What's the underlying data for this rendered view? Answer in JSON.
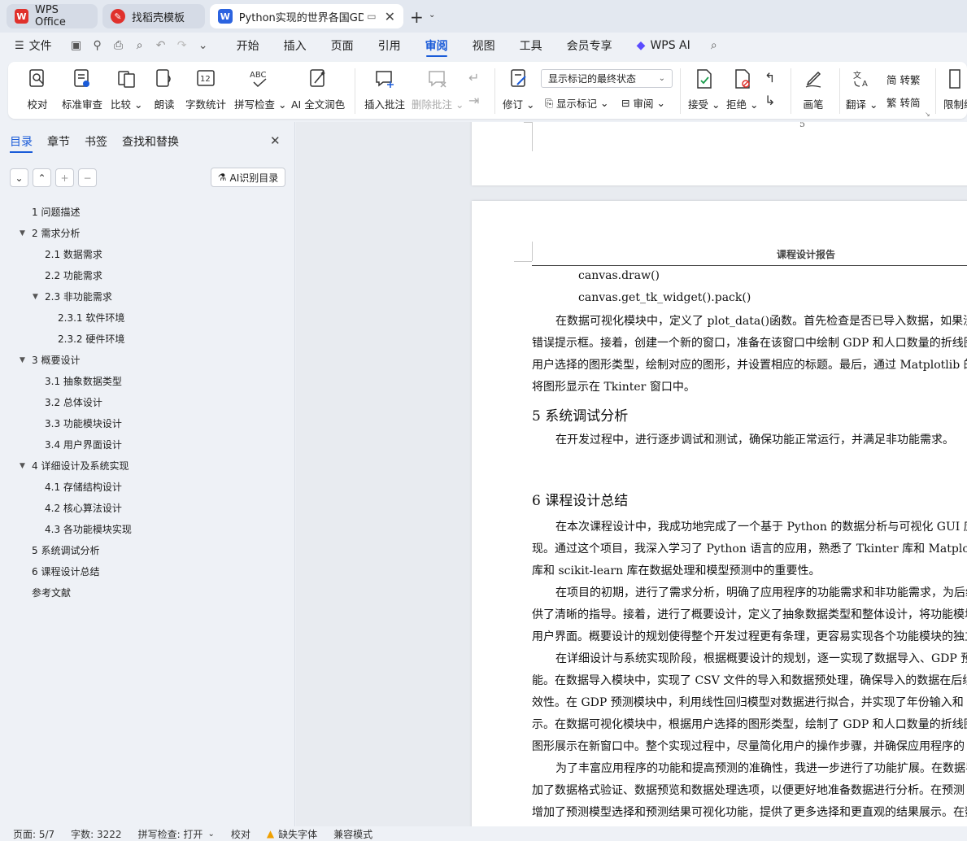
{
  "tabs": [
    {
      "label": "WPS Office",
      "icon": "wps-logo"
    },
    {
      "label": "找稻壳模板",
      "icon": "docer-logo"
    },
    {
      "label": "Python实现的世界各国GDP和",
      "icon": "writer-logo"
    }
  ],
  "menu": {
    "file": "文件",
    "items": [
      "开始",
      "插入",
      "页面",
      "引用",
      "审阅",
      "视图",
      "工具",
      "会员专享"
    ],
    "active": "审阅",
    "wps_ai": "WPS AI"
  },
  "ribbon": {
    "proofread": "校对",
    "std_review": "标准审查",
    "compare": "比较",
    "read_aloud": "朗读",
    "word_count": "字数统计",
    "spell_check": "拼写检查",
    "ai_polish": "AI 全文润色",
    "insert_comment": "插入批注",
    "delete_comment": "删除批注",
    "revise": "修订",
    "markup_select": "显示标记的最终状态",
    "show_markup": "显示标记",
    "review": "审阅",
    "accept": "接受",
    "reject": "拒绝",
    "pen": "画笔",
    "translate": "翻译",
    "to_traditional": "转繁",
    "to_simplified": "转简",
    "restrict": "限制编"
  },
  "panel": {
    "tabs": [
      "目录",
      "章节",
      "书签",
      "查找和替换"
    ],
    "ai_toc": "AI识别目录",
    "toc": [
      {
        "label": "1  问题描述",
        "level": 1,
        "arrow": false
      },
      {
        "label": "2  需求分析",
        "level": 1,
        "arrow": true
      },
      {
        "label": "2.1  数据需求",
        "level": 2,
        "arrow": false
      },
      {
        "label": "2.2  功能需求",
        "level": 2,
        "arrow": false
      },
      {
        "label": "2.3  非功能需求",
        "level": 2,
        "arrow": true
      },
      {
        "label": "2.3.1 软件环境",
        "level": 3,
        "arrow": false
      },
      {
        "label": "2.3.2 硬件环境",
        "level": 3,
        "arrow": false
      },
      {
        "label": "3  概要设计",
        "level": 1,
        "arrow": true
      },
      {
        "label": "3.1 抽象数据类型",
        "level": 2,
        "arrow": false
      },
      {
        "label": "3.2  总体设计",
        "level": 2,
        "arrow": false
      },
      {
        "label": "3.3  功能模块设计",
        "level": 2,
        "arrow": false
      },
      {
        "label": "3.4  用户界面设计",
        "level": 2,
        "arrow": false
      },
      {
        "label": "4  详细设计及系统实现",
        "level": 1,
        "arrow": true
      },
      {
        "label": "4.1  存储结构设计",
        "level": 2,
        "arrow": false
      },
      {
        "label": "4.2  核心算法设计",
        "level": 2,
        "arrow": false
      },
      {
        "label": "4.3  各功能模块实现",
        "level": 2,
        "arrow": false
      },
      {
        "label": "5  系统调试分析",
        "level": 1,
        "arrow": false
      },
      {
        "label": "6  课程设计总结",
        "level": 1,
        "arrow": false
      },
      {
        "label": "参考文献",
        "level": 1,
        "arrow": false
      }
    ]
  },
  "document": {
    "prev_page_number": "5",
    "header": "课程设计报告",
    "lines": [
      "canvas.draw()",
      "canvas.get_tk_widget().pack()",
      "在数据可视化模块中，定义了 plot_data()函数。首先检查是否已导入数据，如果没有",
      "错误提示框。接着，创建一个新的窗口，准备在该窗口中绘制 GDP 和人口数量的折线图",
      "用户选择的图形类型，绘制对应的图形，并设置相应的标题。最后，通过 Matplotlib 的 F",
      "将图形显示在 Tkinter 窗口中。",
      "5  系统调试分析",
      "在开发过程中，进行逐步调试和测试，确保功能正常运行，并满足非功能需求。",
      "6  课程设计总结",
      "在本次课程设计中，我成功地完成了一个基于 Python 的数据分析与可视化 GUI 应用",
      "现。通过这个项目，我深入学习了 Python 语言的应用，熟悉了 Tkinter 库和 Matplotlib 库的",
      "库和 scikit-learn 库在数据处理和模型预测中的重要性。",
      "在项目的初期，进行了需求分析，明确了应用程序的功能需求和非功能需求，为后续",
      "供了清晰的指导。接着，进行了概要设计，定义了抽象数据类型和整体设计，将功能模块",
      "用户界面。概要设计的规划使得整个开发过程更有条理，更容易实现各个功能模块的独立",
      "在详细设计与系统实现阶段，根据概要设计的规划，逐一实现了数据导入、GDP 预测",
      "能。在数据导入模块中，实现了 CSV 文件的导入和数据预处理，确保导入的数据在后续",
      "效性。在 GDP 预测模块中，利用线性回归模型对数据进行拟合，并实现了年份输入和 G",
      "示。在数据可视化模块中，根据用户选择的图形类型，绘制了 GDP 和人口数量的折线图",
      "图形展示在新窗口中。整个实现过程中，尽量简化用户的操作步骤，并确保应用程序的",
      "为了丰富应用程序的功能和提高预测的准确性，我进一步进行了功能扩展。在数据导",
      "加了数据格式验证、数据预览和数据处理选项，以便更好地准备数据进行分析。在预测",
      "增加了预测模型选择和预测结果可视化功能，提供了更多选择和更直观的结果展示。在数"
    ]
  },
  "status": {
    "page": "页面: 5/7",
    "words": "字数: 3222",
    "spell": "拼写检查: 打开",
    "proof": "校对",
    "missing_font": "缺失字体",
    "compat": "兼容模式"
  },
  "colors": {
    "accent": "#1a5bd8",
    "wps_red": "#e0312c",
    "writer_blue": "#2b63e0"
  }
}
